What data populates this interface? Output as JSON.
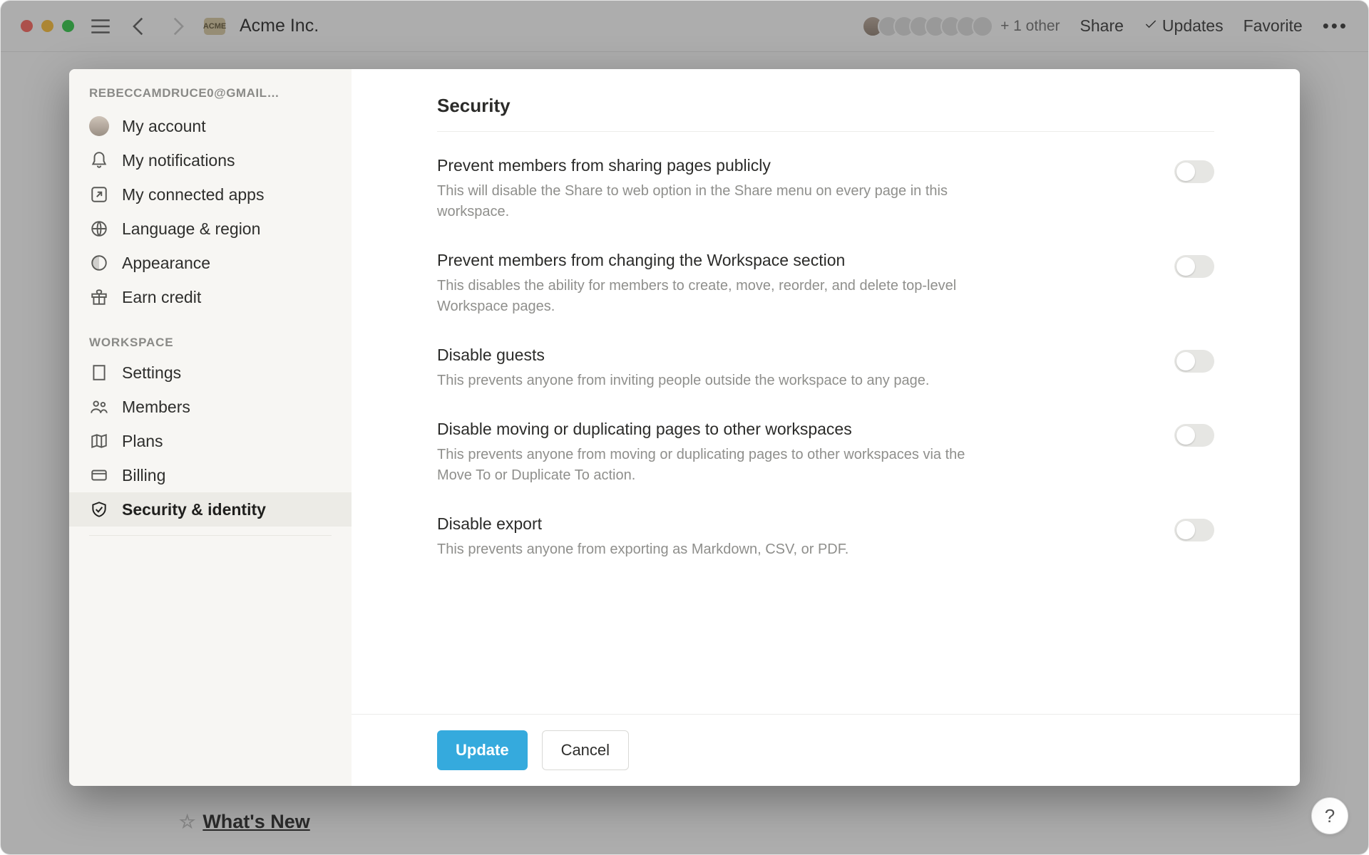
{
  "titlebar": {
    "workspace_name": "Acme Inc.",
    "plus_other": "+ 1 other",
    "share": "Share",
    "updates": "Updates",
    "favorite": "Favorite"
  },
  "underpage": {
    "whats_new": "What's New"
  },
  "sidebar": {
    "email_truncated": "REBECCAMDRUCE0@GMAIL…",
    "account_items": [
      {
        "label": "My account"
      },
      {
        "label": "My notifications"
      },
      {
        "label": "My connected apps"
      },
      {
        "label": "Language & region"
      },
      {
        "label": "Appearance"
      },
      {
        "label": "Earn credit"
      }
    ],
    "workspace_header": "WORKSPACE",
    "workspace_items": [
      {
        "label": "Settings"
      },
      {
        "label": "Members"
      },
      {
        "label": "Plans"
      },
      {
        "label": "Billing"
      },
      {
        "label": "Security & identity"
      }
    ]
  },
  "main": {
    "title": "Security",
    "settings": [
      {
        "title": "Prevent members from sharing pages publicly",
        "desc": "This will disable the Share to web option in the Share menu on every page in this workspace."
      },
      {
        "title": "Prevent members from changing the Workspace section",
        "desc": "This disables the ability for members to create, move, reorder, and delete top-level Workspace pages."
      },
      {
        "title": "Disable guests",
        "desc": "This prevents anyone from inviting people outside the workspace to any page."
      },
      {
        "title": "Disable moving or duplicating pages to other workspaces",
        "desc": "This prevents anyone from moving or duplicating pages to other workspaces via the Move To or Duplicate To action."
      },
      {
        "title": "Disable export",
        "desc": "This prevents anyone from exporting as Markdown, CSV, or PDF."
      }
    ],
    "update_btn": "Update",
    "cancel_btn": "Cancel"
  },
  "help_label": "?"
}
